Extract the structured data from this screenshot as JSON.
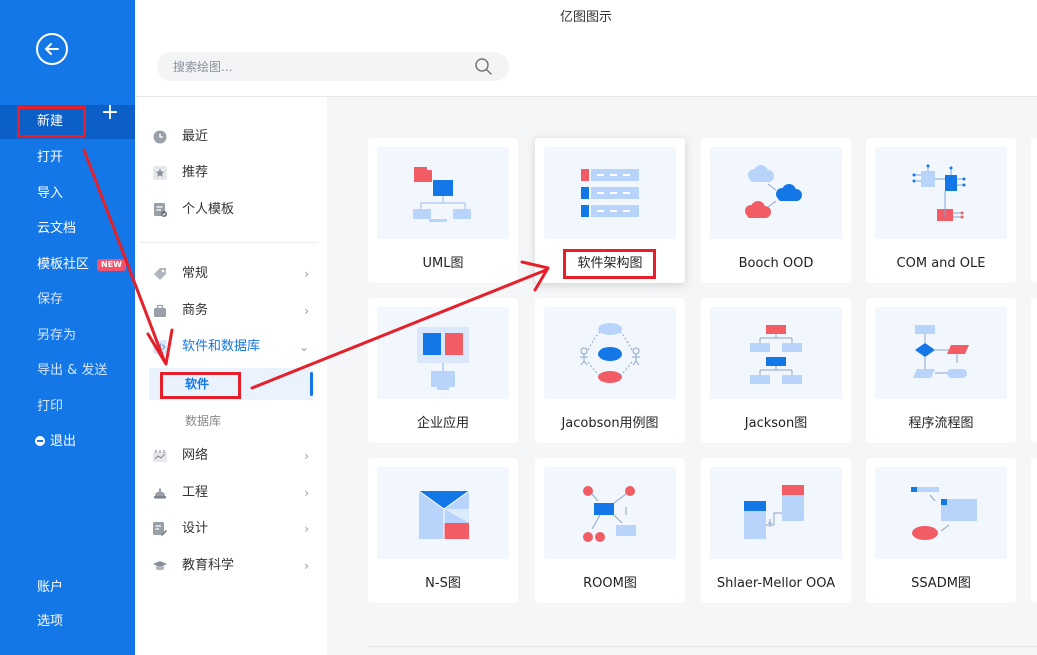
{
  "app": {
    "title": "亿图图示"
  },
  "search": {
    "placeholder": "搜索绘图..."
  },
  "sidebar": {
    "new_label": "新建",
    "plus": "+",
    "items": [
      {
        "label": "打开"
      },
      {
        "label": "导入"
      },
      {
        "label": "云文档"
      },
      {
        "label": "模板社区",
        "badge": "NEW"
      },
      {
        "label": "保存"
      },
      {
        "label": "另存为"
      },
      {
        "label": "导出 & 发送"
      },
      {
        "label": "打印"
      },
      {
        "label": "退出"
      }
    ],
    "bottom": [
      {
        "label": "账户"
      },
      {
        "label": "选项"
      }
    ]
  },
  "categories": {
    "top": [
      {
        "label": "最近"
      },
      {
        "label": "推荐"
      },
      {
        "label": "个人模板"
      }
    ],
    "main": [
      {
        "label": "常规",
        "chevron": "›"
      },
      {
        "label": "商务",
        "chevron": "›"
      },
      {
        "label": "软件和数据库",
        "chevron": "⌄"
      },
      {
        "label": "网络",
        "chevron": "›"
      },
      {
        "label": "工程",
        "chevron": "›"
      },
      {
        "label": "设计",
        "chevron": "›"
      },
      {
        "label": "教育科学",
        "chevron": "›"
      }
    ],
    "sub": [
      {
        "label": "软件"
      },
      {
        "label": "数据库"
      }
    ]
  },
  "templates": [
    {
      "label": "UML图"
    },
    {
      "label": "软件架构图"
    },
    {
      "label": "Booch OOD"
    },
    {
      "label": "COM and OLE"
    },
    {
      "label": "企业应用"
    },
    {
      "label": "Jacobson用例图"
    },
    {
      "label": "Jackson图"
    },
    {
      "label": "程序流程图"
    },
    {
      "label": "N-S图"
    },
    {
      "label": "ROOM图"
    },
    {
      "label": "Shlaer-Mellor OOA"
    },
    {
      "label": "SSADM图"
    }
  ],
  "colors": {
    "sidebar": "#1477e8",
    "accent": "#1477e8",
    "annotation": "#e5202a",
    "thumb_red": "#f25c64",
    "thumb_blue": "#1477e8",
    "thumb_light": "#b8d4fb"
  },
  "icons": {
    "back": "back-arrow-icon",
    "search": "search-icon"
  }
}
